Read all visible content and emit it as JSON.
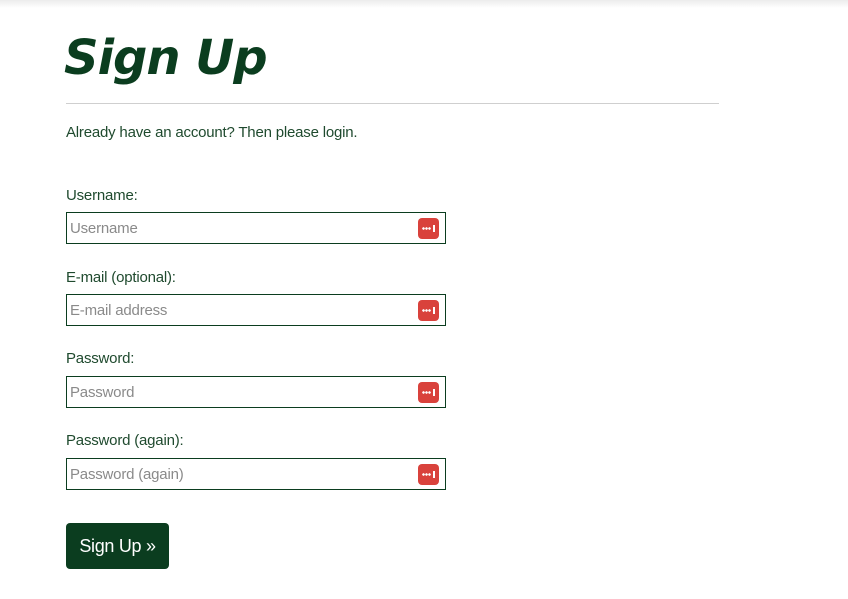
{
  "page": {
    "title": "Sign Up"
  },
  "login_prompt": {
    "before": "Already have an account? Then please ",
    "link": "login",
    "after": "."
  },
  "fields": [
    {
      "label": "Username:",
      "placeholder": "Username",
      "value": ""
    },
    {
      "label": "E-mail (optional):",
      "placeholder": "E-mail address",
      "value": ""
    },
    {
      "label": "Password:",
      "placeholder": "Password",
      "value": ""
    },
    {
      "label": "Password (again):",
      "placeholder": "Password (again)",
      "value": ""
    }
  ],
  "submit": {
    "label": "Sign Up »"
  },
  "icons": {
    "field_icon": "password-manager-icon"
  },
  "colors": {
    "primary": "#0b3d1f",
    "text": "#1f4a2e",
    "icon": "#d9423c",
    "divider": "#cfcfcf"
  }
}
